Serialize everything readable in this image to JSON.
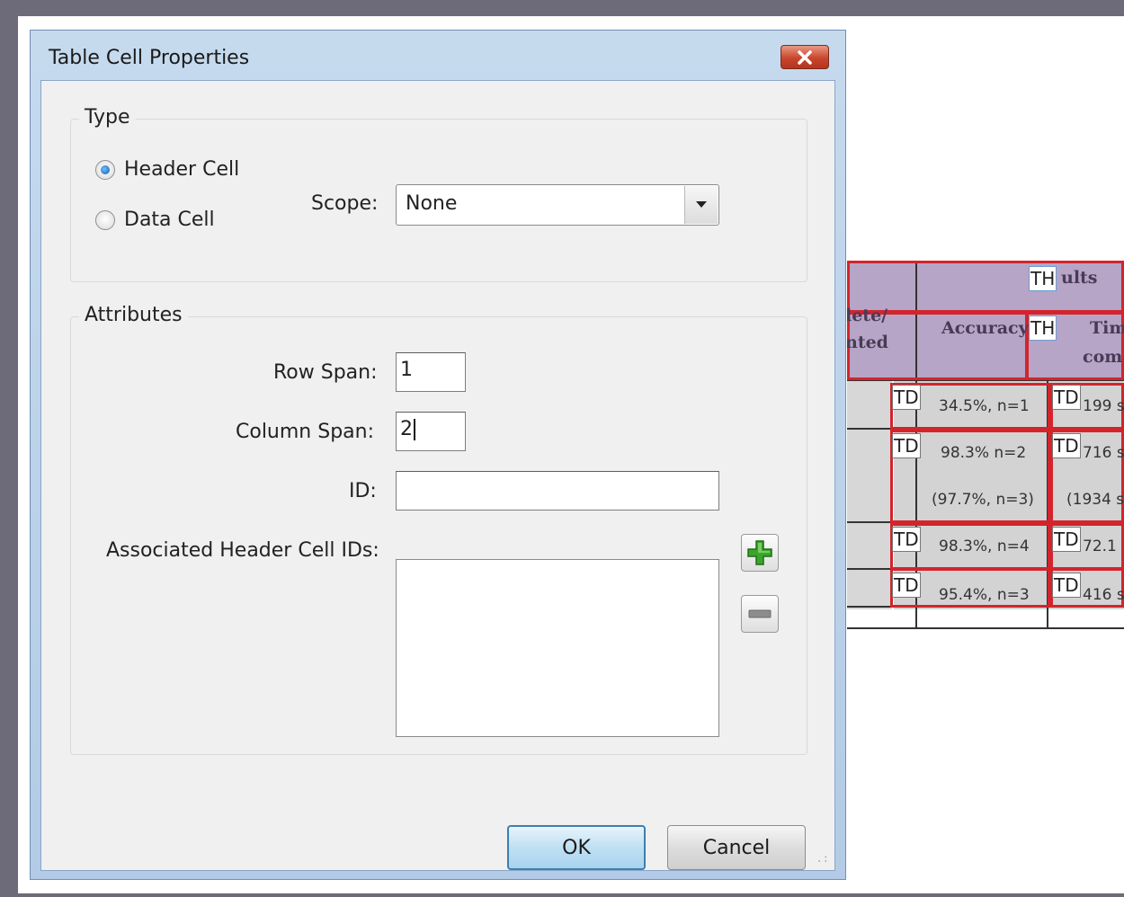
{
  "dialog": {
    "title": "Table Cell Properties",
    "type_group": {
      "legend": "Type",
      "header_cell_label": "Header Cell",
      "data_cell_label": "Data Cell",
      "selected": "Header Cell",
      "scope_label": "Scope:",
      "scope_value": "None"
    },
    "attributes_group": {
      "legend": "Attributes",
      "row_span_label": "Row Span:",
      "row_span_value": "1",
      "column_span_label": "Column Span:",
      "column_span_value": "2",
      "id_label": "ID:",
      "id_value": "",
      "associated_label": "Associated Header Cell IDs:",
      "associated_items": []
    },
    "buttons": {
      "ok": "OK",
      "cancel": "Cancel"
    },
    "icons": {
      "close": "close-icon",
      "add": "plus-icon",
      "remove": "minus-icon"
    }
  },
  "background_table": {
    "header_texts": [
      "lete/",
      "nted",
      "Accuracy",
      "ults",
      "Tim",
      "com"
    ],
    "tags": {
      "th": "TH",
      "td": "TD"
    },
    "cells": {
      "r1c1": "34.5%, n=1",
      "r1c2": "199 s",
      "r2c1a": "98.3% n=2",
      "r2c1b": "(97.7%, n=3)",
      "r2c2a": "716 s",
      "r2c2b": "(1934 s",
      "r3c1": "98.3%, n=4",
      "r3c2": "72.1",
      "r4c1": "95.4%, n=3",
      "r4c2": "416 s"
    }
  },
  "colors": {
    "frame": "#6d6a79",
    "header_fill": "#b6a5c6",
    "tag_outline_red": "#d3242c",
    "ok_border": "#3c7fb1"
  }
}
